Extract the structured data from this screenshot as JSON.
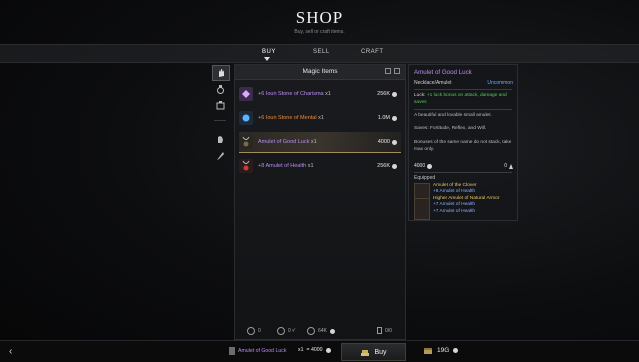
{
  "header": {
    "title": "SHOP",
    "subtitle": "Buy, sell or craft items."
  },
  "tabs": [
    {
      "label": "BUY",
      "active": true
    },
    {
      "label": "SELL",
      "active": false
    },
    {
      "label": "CRAFT",
      "active": false
    }
  ],
  "sidebar": {
    "categories": [
      {
        "icon": "hand-icon",
        "active": true
      },
      {
        "icon": "potion-icon",
        "active": false
      },
      {
        "icon": "chest-icon",
        "active": false
      },
      {
        "icon": "glove-icon",
        "active": false
      },
      {
        "icon": "feather-icon",
        "active": false
      }
    ]
  },
  "list": {
    "header": "Magic Items",
    "items": [
      {
        "name": "+6 Ioun Stone of Charisma",
        "qty": "x1",
        "price": "256K",
        "color": "#b98cf0",
        "icon": "gem-icon",
        "selected": false
      },
      {
        "name": "+6 Ioun Stone of Mental",
        "qty": "x1",
        "price": "1.0M",
        "color": "#ee8a3c",
        "icon": "orb-icon",
        "selected": false
      },
      {
        "name": "Amulet of Good Luck",
        "qty": "x1",
        "price": "4000",
        "color": "#b98cf0",
        "icon": "amulet-icon",
        "selected": true
      },
      {
        "name": "+8 Amulet of Health",
        "qty": "x1",
        "price": "256K",
        "color": "#b98cf0",
        "icon": "amulet-red-icon",
        "selected": false
      }
    ],
    "footer": {
      "stat1": "0",
      "stat2": "0 ¹⁄",
      "stat3": "64K",
      "stat4": "0/0"
    }
  },
  "detail": {
    "title": "Amulet of Good Luck",
    "type": "Necklace/Amulet",
    "rarity": "Uncommon",
    "effect_prefix": "Luck:",
    "effect": "+1 luck bonus on attack, damage and saves",
    "description": "A beautiful and lovable small amulet.",
    "saves": "Saves: Fortitude, Reflex, and Will.",
    "note": "Bonuses of the same name do not stack, take max only.",
    "price": "4000",
    "weight": "0",
    "equipped_label": "Equipped",
    "equipped": [
      {
        "name": "Amulet of the Clover",
        "stat": "+8 Amulet of Health"
      },
      {
        "name": "Higher Amulet of Natural Armor",
        "stats": [
          "+7 Amulet of Health",
          "+7 Amulet of Health"
        ]
      }
    ]
  },
  "bottom": {
    "back": "‹",
    "item": "Amulet of Good Luck",
    "qty": "x1",
    "eq": "= 4000",
    "buy": "Buy",
    "gold": "19G"
  }
}
